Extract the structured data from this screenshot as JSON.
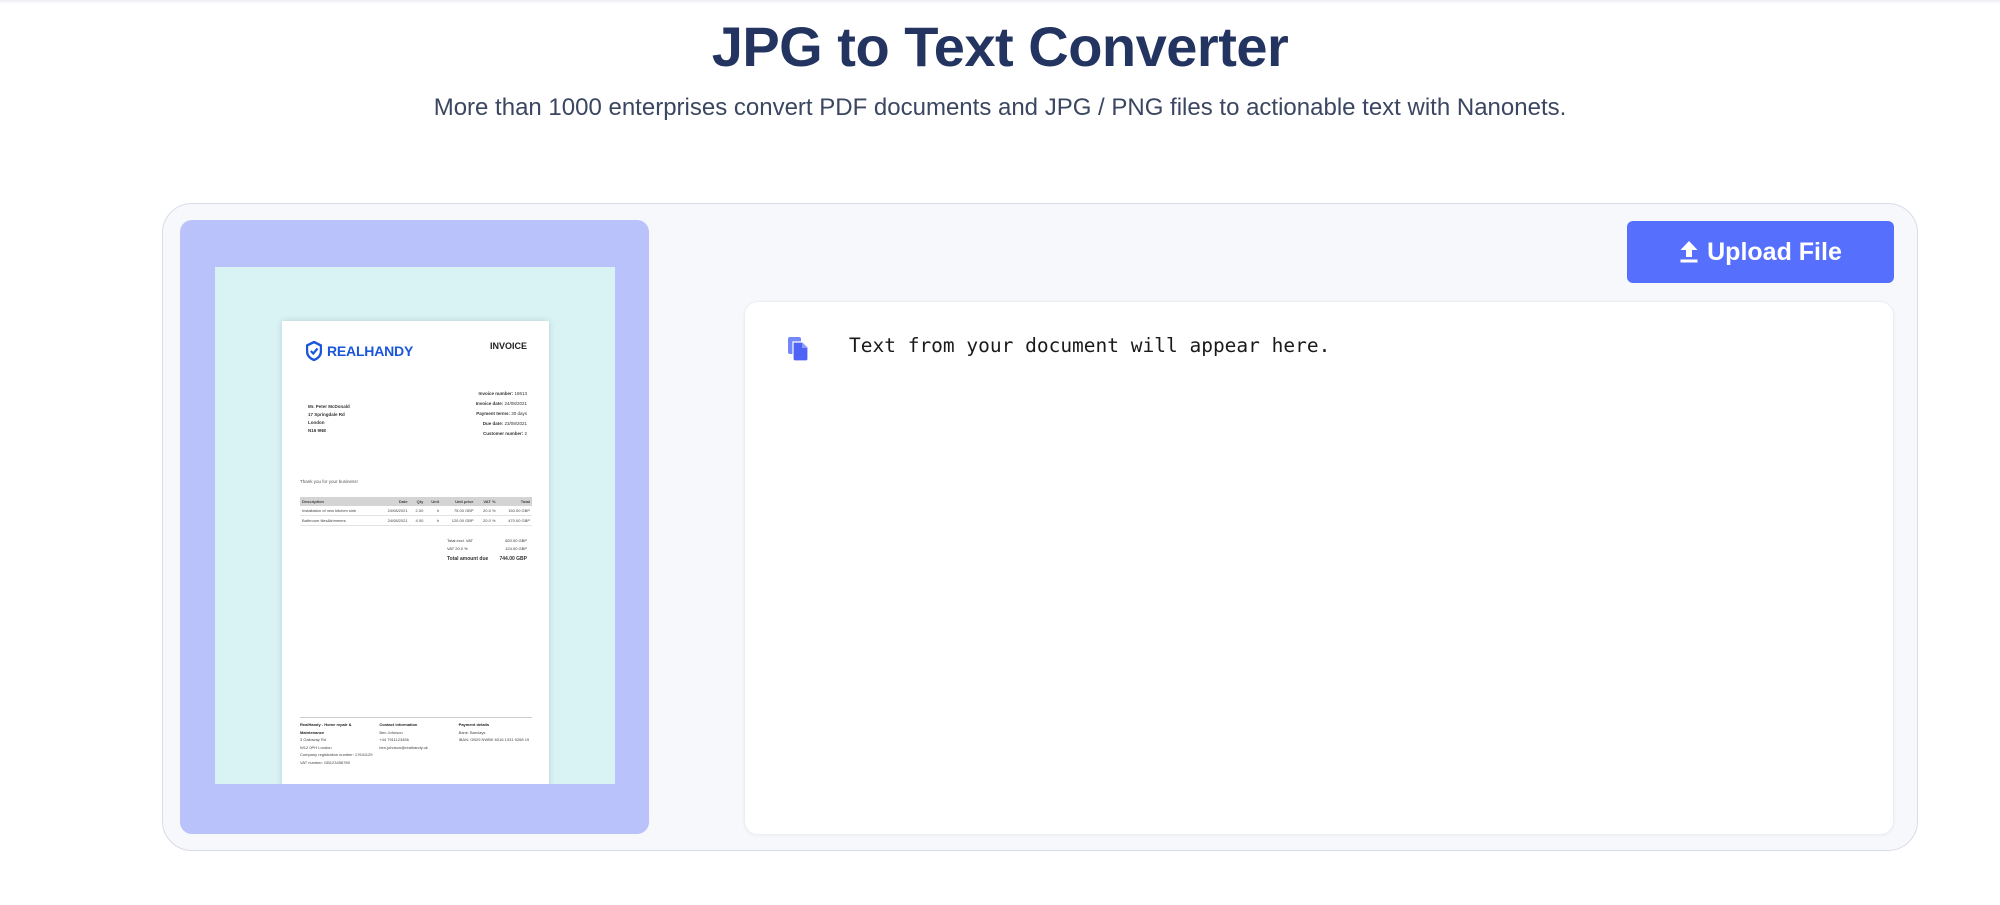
{
  "header": {
    "title": "JPG to Text Converter",
    "subtitle": "More than 1000 enterprises convert PDF documents and JPG / PNG files to actionable text with Nanonets."
  },
  "colors": {
    "accent": "#566ffc",
    "title": "#233461",
    "preview_frame": "#b9c2fb",
    "preview_bg": "#d9f3f4",
    "invoice_brand": "#1a56db"
  },
  "upload": {
    "label": "Upload File",
    "icon": "upload-arrow-icon"
  },
  "output": {
    "placeholder": "Text from your document will appear here.",
    "icon": "copy-document-icon"
  },
  "invoice": {
    "brand": "REALHANDY",
    "title": "INVOICE",
    "meta": [
      {
        "label": "Invoice number:",
        "value": "18613"
      },
      {
        "label": "Invoice date:",
        "value": "24/08/2021"
      },
      {
        "label": "Payment terms:",
        "value": "30 days"
      },
      {
        "label": "Due date:",
        "value": "23/09/2021"
      },
      {
        "label": "Customer number:",
        "value": "2"
      }
    ],
    "address": [
      "Mr. Peter McDonald",
      "17 Springdale Rd",
      "London",
      "N16 9NE"
    ],
    "thanks": "Thank you for your business!",
    "table_headers": [
      "Description",
      "Date",
      "Qty",
      "Unit",
      "Unit price",
      "VAT %",
      "Total"
    ],
    "table_rows": [
      [
        "Installation of new kitchen sink",
        "24/08/2021",
        "2.00",
        "h",
        "75.00 GBP",
        "20.0 %",
        "150.00 GBP"
      ],
      [
        "Bathroom tiles&trimmers",
        "24/08/2021",
        "4.00",
        "h",
        "120.00 GBP",
        "20.0 %",
        "470.00 GBP"
      ]
    ],
    "totals": [
      {
        "label": "Total excl. VAT",
        "value": "620.00 GBP"
      },
      {
        "label": "VAT 20.0 %",
        "value": "124.00 GBP"
      }
    ],
    "total_due": {
      "label": "Total amount due",
      "value": "744.00 GBP"
    },
    "footer": [
      {
        "heading": "RealHandy - Home repair & Maintenance",
        "lines": [
          "3 Galloway Rd",
          "W12 0PH London",
          "Company registration number: 17641129",
          "VAT number: GB123456789"
        ]
      },
      {
        "heading": "Contact information",
        "lines": [
          "Ben Johnson",
          "+44 7911123456",
          "ben.johnson@realhandy.uk"
        ]
      },
      {
        "heading": "Payment details",
        "lines": [
          "Bank: Barclays",
          "IBAN: GB29 NWBK 6016 1331 9268 19"
        ]
      }
    ]
  }
}
